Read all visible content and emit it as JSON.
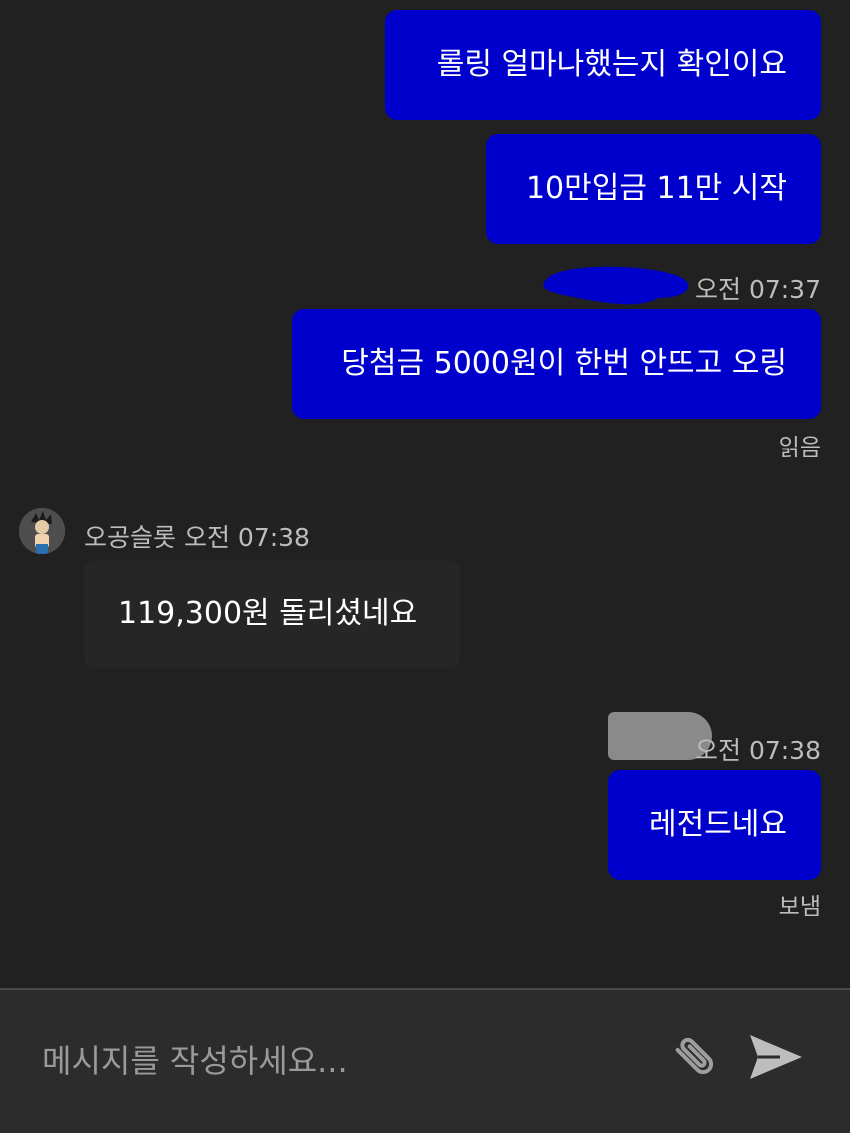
{
  "messages": {
    "m1": {
      "text": "롤링 얼마나했는지 확인이요"
    },
    "m2": {
      "text": "10만입금 11만 시작"
    },
    "m3": {
      "time": "오전 07:37",
      "text": "당첨금 5000원이 한번 안뜨고 오링",
      "status": "읽음"
    },
    "m4": {
      "sender": "오공슬롯",
      "time": "오전 07:38",
      "text": "119,300원 돌리셨네요"
    },
    "m5": {
      "time": "오전 07:38",
      "text": "레전드네요",
      "status": "보냄"
    }
  },
  "composer": {
    "placeholder": "메시지를 작성하세요..."
  },
  "icons": {
    "attach": "paperclip-icon",
    "send": "send-icon"
  },
  "colors": {
    "background": "#212121",
    "outgoing_bubble": "#0000cc",
    "incoming_bubble": "#262626",
    "meta_text": "#bdbdbd"
  }
}
